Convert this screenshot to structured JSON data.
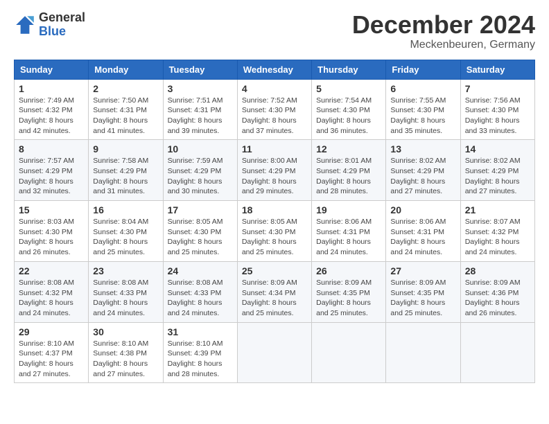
{
  "logo": {
    "general": "General",
    "blue": "Blue"
  },
  "header": {
    "month": "December 2024",
    "location": "Meckenbeuren, Germany"
  },
  "weekdays": [
    "Sunday",
    "Monday",
    "Tuesday",
    "Wednesday",
    "Thursday",
    "Friday",
    "Saturday"
  ],
  "weeks": [
    [
      {
        "day": "1",
        "sunrise": "7:49 AM",
        "sunset": "4:32 PM",
        "daylight": "8 hours and 42 minutes."
      },
      {
        "day": "2",
        "sunrise": "7:50 AM",
        "sunset": "4:31 PM",
        "daylight": "8 hours and 41 minutes."
      },
      {
        "day": "3",
        "sunrise": "7:51 AM",
        "sunset": "4:31 PM",
        "daylight": "8 hours and 39 minutes."
      },
      {
        "day": "4",
        "sunrise": "7:52 AM",
        "sunset": "4:30 PM",
        "daylight": "8 hours and 37 minutes."
      },
      {
        "day": "5",
        "sunrise": "7:54 AM",
        "sunset": "4:30 PM",
        "daylight": "8 hours and 36 minutes."
      },
      {
        "day": "6",
        "sunrise": "7:55 AM",
        "sunset": "4:30 PM",
        "daylight": "8 hours and 35 minutes."
      },
      {
        "day": "7",
        "sunrise": "7:56 AM",
        "sunset": "4:30 PM",
        "daylight": "8 hours and 33 minutes."
      }
    ],
    [
      {
        "day": "8",
        "sunrise": "7:57 AM",
        "sunset": "4:29 PM",
        "daylight": "8 hours and 32 minutes."
      },
      {
        "day": "9",
        "sunrise": "7:58 AM",
        "sunset": "4:29 PM",
        "daylight": "8 hours and 31 minutes."
      },
      {
        "day": "10",
        "sunrise": "7:59 AM",
        "sunset": "4:29 PM",
        "daylight": "8 hours and 30 minutes."
      },
      {
        "day": "11",
        "sunrise": "8:00 AM",
        "sunset": "4:29 PM",
        "daylight": "8 hours and 29 minutes."
      },
      {
        "day": "12",
        "sunrise": "8:01 AM",
        "sunset": "4:29 PM",
        "daylight": "8 hours and 28 minutes."
      },
      {
        "day": "13",
        "sunrise": "8:02 AM",
        "sunset": "4:29 PM",
        "daylight": "8 hours and 27 minutes."
      },
      {
        "day": "14",
        "sunrise": "8:02 AM",
        "sunset": "4:29 PM",
        "daylight": "8 hours and 27 minutes."
      }
    ],
    [
      {
        "day": "15",
        "sunrise": "8:03 AM",
        "sunset": "4:30 PM",
        "daylight": "8 hours and 26 minutes."
      },
      {
        "day": "16",
        "sunrise": "8:04 AM",
        "sunset": "4:30 PM",
        "daylight": "8 hours and 25 minutes."
      },
      {
        "day": "17",
        "sunrise": "8:05 AM",
        "sunset": "4:30 PM",
        "daylight": "8 hours and 25 minutes."
      },
      {
        "day": "18",
        "sunrise": "8:05 AM",
        "sunset": "4:30 PM",
        "daylight": "8 hours and 25 minutes."
      },
      {
        "day": "19",
        "sunrise": "8:06 AM",
        "sunset": "4:31 PM",
        "daylight": "8 hours and 24 minutes."
      },
      {
        "day": "20",
        "sunrise": "8:06 AM",
        "sunset": "4:31 PM",
        "daylight": "8 hours and 24 minutes."
      },
      {
        "day": "21",
        "sunrise": "8:07 AM",
        "sunset": "4:32 PM",
        "daylight": "8 hours and 24 minutes."
      }
    ],
    [
      {
        "day": "22",
        "sunrise": "8:08 AM",
        "sunset": "4:32 PM",
        "daylight": "8 hours and 24 minutes."
      },
      {
        "day": "23",
        "sunrise": "8:08 AM",
        "sunset": "4:33 PM",
        "daylight": "8 hours and 24 minutes."
      },
      {
        "day": "24",
        "sunrise": "8:08 AM",
        "sunset": "4:33 PM",
        "daylight": "8 hours and 24 minutes."
      },
      {
        "day": "25",
        "sunrise": "8:09 AM",
        "sunset": "4:34 PM",
        "daylight": "8 hours and 25 minutes."
      },
      {
        "day": "26",
        "sunrise": "8:09 AM",
        "sunset": "4:35 PM",
        "daylight": "8 hours and 25 minutes."
      },
      {
        "day": "27",
        "sunrise": "8:09 AM",
        "sunset": "4:35 PM",
        "daylight": "8 hours and 25 minutes."
      },
      {
        "day": "28",
        "sunrise": "8:09 AM",
        "sunset": "4:36 PM",
        "daylight": "8 hours and 26 minutes."
      }
    ],
    [
      {
        "day": "29",
        "sunrise": "8:10 AM",
        "sunset": "4:37 PM",
        "daylight": "8 hours and 27 minutes."
      },
      {
        "day": "30",
        "sunrise": "8:10 AM",
        "sunset": "4:38 PM",
        "daylight": "8 hours and 27 minutes."
      },
      {
        "day": "31",
        "sunrise": "8:10 AM",
        "sunset": "4:39 PM",
        "daylight": "8 hours and 28 minutes."
      },
      null,
      null,
      null,
      null
    ]
  ],
  "labels": {
    "sunrise_prefix": "Sunrise: ",
    "sunset_prefix": "Sunset: ",
    "daylight_prefix": "Daylight: "
  }
}
